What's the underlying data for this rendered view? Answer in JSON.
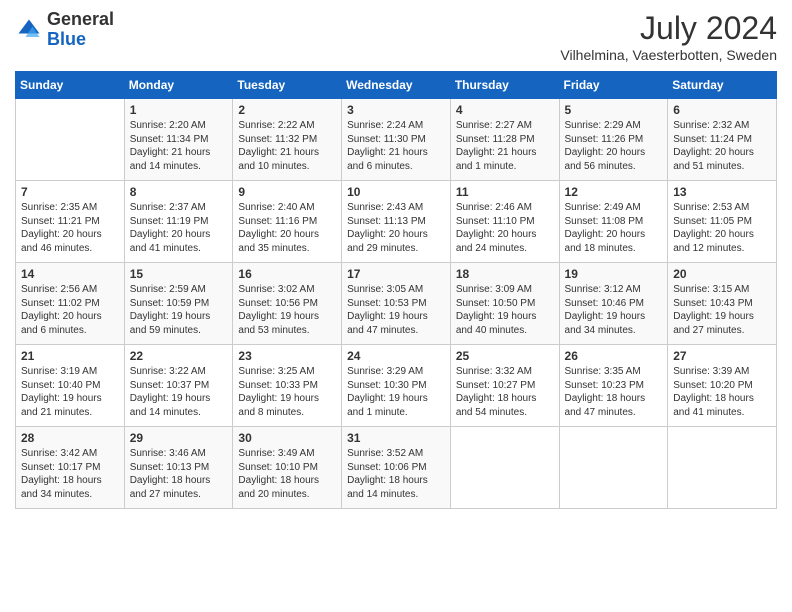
{
  "header": {
    "logo": {
      "general": "General",
      "blue": "Blue"
    },
    "title": "July 2024",
    "location": "Vilhelmina, Vaesterbotten, Sweden"
  },
  "days_of_week": [
    "Sunday",
    "Monday",
    "Tuesday",
    "Wednesday",
    "Thursday",
    "Friday",
    "Saturday"
  ],
  "weeks": [
    [
      {
        "day": "",
        "sunrise": "",
        "sunset": "",
        "daylight": ""
      },
      {
        "day": "1",
        "sunrise": "Sunrise: 2:20 AM",
        "sunset": "Sunset: 11:34 PM",
        "daylight": "Daylight: 21 hours and 14 minutes."
      },
      {
        "day": "2",
        "sunrise": "Sunrise: 2:22 AM",
        "sunset": "Sunset: 11:32 PM",
        "daylight": "Daylight: 21 hours and 10 minutes."
      },
      {
        "day": "3",
        "sunrise": "Sunrise: 2:24 AM",
        "sunset": "Sunset: 11:30 PM",
        "daylight": "Daylight: 21 hours and 6 minutes."
      },
      {
        "day": "4",
        "sunrise": "Sunrise: 2:27 AM",
        "sunset": "Sunset: 11:28 PM",
        "daylight": "Daylight: 21 hours and 1 minute."
      },
      {
        "day": "5",
        "sunrise": "Sunrise: 2:29 AM",
        "sunset": "Sunset: 11:26 PM",
        "daylight": "Daylight: 20 hours and 56 minutes."
      },
      {
        "day": "6",
        "sunrise": "Sunrise: 2:32 AM",
        "sunset": "Sunset: 11:24 PM",
        "daylight": "Daylight: 20 hours and 51 minutes."
      }
    ],
    [
      {
        "day": "7",
        "sunrise": "Sunrise: 2:35 AM",
        "sunset": "Sunset: 11:21 PM",
        "daylight": "Daylight: 20 hours and 46 minutes."
      },
      {
        "day": "8",
        "sunrise": "Sunrise: 2:37 AM",
        "sunset": "Sunset: 11:19 PM",
        "daylight": "Daylight: 20 hours and 41 minutes."
      },
      {
        "day": "9",
        "sunrise": "Sunrise: 2:40 AM",
        "sunset": "Sunset: 11:16 PM",
        "daylight": "Daylight: 20 hours and 35 minutes."
      },
      {
        "day": "10",
        "sunrise": "Sunrise: 2:43 AM",
        "sunset": "Sunset: 11:13 PM",
        "daylight": "Daylight: 20 hours and 29 minutes."
      },
      {
        "day": "11",
        "sunrise": "Sunrise: 2:46 AM",
        "sunset": "Sunset: 11:10 PM",
        "daylight": "Daylight: 20 hours and 24 minutes."
      },
      {
        "day": "12",
        "sunrise": "Sunrise: 2:49 AM",
        "sunset": "Sunset: 11:08 PM",
        "daylight": "Daylight: 20 hours and 18 minutes."
      },
      {
        "day": "13",
        "sunrise": "Sunrise: 2:53 AM",
        "sunset": "Sunset: 11:05 PM",
        "daylight": "Daylight: 20 hours and 12 minutes."
      }
    ],
    [
      {
        "day": "14",
        "sunrise": "Sunrise: 2:56 AM",
        "sunset": "Sunset: 11:02 PM",
        "daylight": "Daylight: 20 hours and 6 minutes."
      },
      {
        "day": "15",
        "sunrise": "Sunrise: 2:59 AM",
        "sunset": "Sunset: 10:59 PM",
        "daylight": "Daylight: 19 hours and 59 minutes."
      },
      {
        "day": "16",
        "sunrise": "Sunrise: 3:02 AM",
        "sunset": "Sunset: 10:56 PM",
        "daylight": "Daylight: 19 hours and 53 minutes."
      },
      {
        "day": "17",
        "sunrise": "Sunrise: 3:05 AM",
        "sunset": "Sunset: 10:53 PM",
        "daylight": "Daylight: 19 hours and 47 minutes."
      },
      {
        "day": "18",
        "sunrise": "Sunrise: 3:09 AM",
        "sunset": "Sunset: 10:50 PM",
        "daylight": "Daylight: 19 hours and 40 minutes."
      },
      {
        "day": "19",
        "sunrise": "Sunrise: 3:12 AM",
        "sunset": "Sunset: 10:46 PM",
        "daylight": "Daylight: 19 hours and 34 minutes."
      },
      {
        "day": "20",
        "sunrise": "Sunrise: 3:15 AM",
        "sunset": "Sunset: 10:43 PM",
        "daylight": "Daylight: 19 hours and 27 minutes."
      }
    ],
    [
      {
        "day": "21",
        "sunrise": "Sunrise: 3:19 AM",
        "sunset": "Sunset: 10:40 PM",
        "daylight": "Daylight: 19 hours and 21 minutes."
      },
      {
        "day": "22",
        "sunrise": "Sunrise: 3:22 AM",
        "sunset": "Sunset: 10:37 PM",
        "daylight": "Daylight: 19 hours and 14 minutes."
      },
      {
        "day": "23",
        "sunrise": "Sunrise: 3:25 AM",
        "sunset": "Sunset: 10:33 PM",
        "daylight": "Daylight: 19 hours and 8 minutes."
      },
      {
        "day": "24",
        "sunrise": "Sunrise: 3:29 AM",
        "sunset": "Sunset: 10:30 PM",
        "daylight": "Daylight: 19 hours and 1 minute."
      },
      {
        "day": "25",
        "sunrise": "Sunrise: 3:32 AM",
        "sunset": "Sunset: 10:27 PM",
        "daylight": "Daylight: 18 hours and 54 minutes."
      },
      {
        "day": "26",
        "sunrise": "Sunrise: 3:35 AM",
        "sunset": "Sunset: 10:23 PM",
        "daylight": "Daylight: 18 hours and 47 minutes."
      },
      {
        "day": "27",
        "sunrise": "Sunrise: 3:39 AM",
        "sunset": "Sunset: 10:20 PM",
        "daylight": "Daylight: 18 hours and 41 minutes."
      }
    ],
    [
      {
        "day": "28",
        "sunrise": "Sunrise: 3:42 AM",
        "sunset": "Sunset: 10:17 PM",
        "daylight": "Daylight: 18 hours and 34 minutes."
      },
      {
        "day": "29",
        "sunrise": "Sunrise: 3:46 AM",
        "sunset": "Sunset: 10:13 PM",
        "daylight": "Daylight: 18 hours and 27 minutes."
      },
      {
        "day": "30",
        "sunrise": "Sunrise: 3:49 AM",
        "sunset": "Sunset: 10:10 PM",
        "daylight": "Daylight: 18 hours and 20 minutes."
      },
      {
        "day": "31",
        "sunrise": "Sunrise: 3:52 AM",
        "sunset": "Sunset: 10:06 PM",
        "daylight": "Daylight: 18 hours and 14 minutes."
      },
      {
        "day": "",
        "sunrise": "",
        "sunset": "",
        "daylight": ""
      },
      {
        "day": "",
        "sunrise": "",
        "sunset": "",
        "daylight": ""
      },
      {
        "day": "",
        "sunrise": "",
        "sunset": "",
        "daylight": ""
      }
    ]
  ]
}
